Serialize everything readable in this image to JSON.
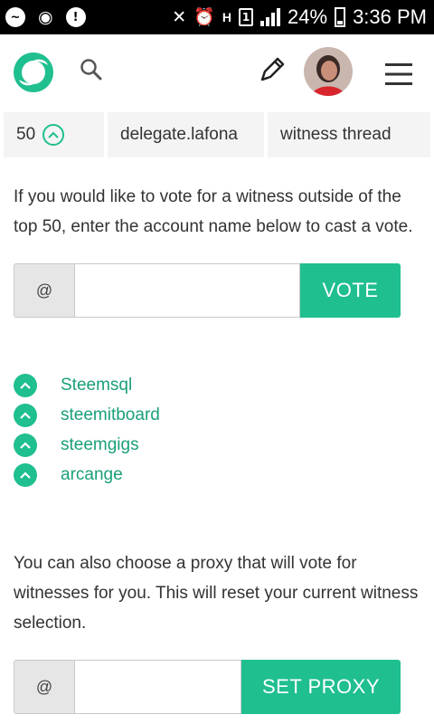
{
  "status_bar": {
    "battery": "24%",
    "time": "3:36 PM",
    "sim": "1",
    "network": "H",
    "left_icons": [
      "messenger-icon",
      "game-controller-icon",
      "warning-icon"
    ],
    "right_icons": [
      "mute-icon",
      "alarm-icon",
      "network-h-icon",
      "sim-icon",
      "signal-icon",
      "battery-icon"
    ]
  },
  "header": {
    "logo_icon": "steemit-logo-icon",
    "search_icon": "search-icon",
    "compose_icon": "pencil-icon",
    "avatar_icon": "user-avatar",
    "menu_icon": "hamburger-menu-icon"
  },
  "witness_row": {
    "rank": "50",
    "name": "delegate.lafona",
    "thread": "witness thread"
  },
  "vote_section": {
    "instructions": "If you would like to vote for a witness outside of the top 50, enter the account name below to cast a vote.",
    "prefix": "@",
    "input_value": "",
    "input_placeholder": "",
    "button_label": "VOTE"
  },
  "voted_witnesses": [
    "Steemsql",
    "steemitboard",
    "steemgigs",
    "arcange"
  ],
  "proxy_section": {
    "instructions": "You can also choose a proxy that will vote for witnesses for you. This will reset your current witness selection.",
    "prefix": "@",
    "input_value": "",
    "input_placeholder": "",
    "button_label": "SET PROXY"
  },
  "colors": {
    "accent": "#1fbf8f",
    "link": "#1a9f7a",
    "statusbar": "#000000",
    "cell_bg": "#f4f4f4"
  }
}
